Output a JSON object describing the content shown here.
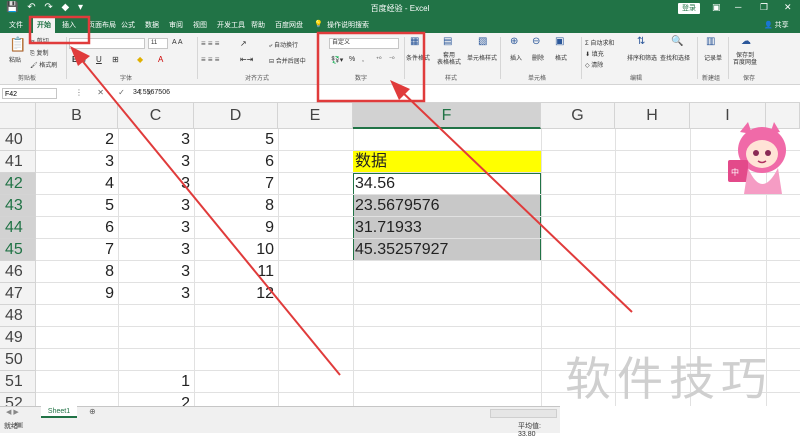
{
  "titlebar": {
    "title": "百度经验 - Excel",
    "login": "登录",
    "qat_icons": [
      "save-icon",
      "undo-icon",
      "redo-icon",
      "paint-icon",
      "dropdown-icon"
    ]
  },
  "tabs": [
    "文件",
    "开始",
    "插入",
    "页面布局",
    "公式",
    "数据",
    "审阅",
    "视图",
    "开发工具",
    "帮助",
    "百度网盘",
    "操作说明搜索"
  ],
  "share": "共享",
  "ribbon": {
    "clipboard": {
      "paste": "粘贴",
      "cut": "剪切",
      "copy": "复制",
      "painter": "格式刷",
      "group": "剪贴板"
    },
    "font": {
      "font_size": "11",
      "group": "字体"
    },
    "alignment": {
      "wrap": "自动换行",
      "merge": "合并后居中",
      "group": "对齐方式"
    },
    "number": {
      "format": "自定义",
      "percent": "%",
      "group": "数字"
    },
    "styles": {
      "cond": "条件格式",
      "table": "套用\n表格格式",
      "cell": "单元格样式",
      "group": "样式"
    },
    "cells": {
      "insert": "插入",
      "delete": "删除",
      "format": "格式",
      "group": "单元格"
    },
    "editing": {
      "autosum": "自动求和",
      "fill": "填充",
      "clear": "清除",
      "sort": "排序和筛选",
      "find": "查找和选择",
      "group": "编辑"
    },
    "newgroup": {
      "record": "记录单",
      "group": "新建组"
    },
    "save": {
      "label": "保存到\n百度网盘",
      "group": "保存"
    }
  },
  "formula": {
    "namebox": "F42",
    "value": "34.5567506"
  },
  "columns": [
    "B",
    "C",
    "D",
    "E",
    "F",
    "G",
    "H",
    "I"
  ],
  "rows": [
    {
      "n": "40",
      "B": "2",
      "C": "3",
      "D": "5"
    },
    {
      "n": "41",
      "B": "3",
      "C": "3",
      "D": "6",
      "F": "数据"
    },
    {
      "n": "42",
      "B": "4",
      "C": "3",
      "D": "7",
      "F": "34.56"
    },
    {
      "n": "43",
      "B": "5",
      "C": "3",
      "D": "8",
      "F": "23.5679576"
    },
    {
      "n": "44",
      "B": "6",
      "C": "3",
      "D": "9",
      "F": "31.71933"
    },
    {
      "n": "45",
      "B": "7",
      "C": "3",
      "D": "10",
      "F": "45.35257927"
    },
    {
      "n": "46",
      "B": "8",
      "C": "3",
      "D": "11"
    },
    {
      "n": "47",
      "B": "9",
      "C": "3",
      "D": "12"
    },
    {
      "n": "48"
    },
    {
      "n": "49"
    },
    {
      "n": "50"
    },
    {
      "n": "51",
      "C": "1"
    },
    {
      "n": "52",
      "C": "2"
    }
  ],
  "sheet_tab": "Sheet1",
  "status": {
    "left": "就绪",
    "right": "平均值: 33.80"
  },
  "watermark": "软件技巧",
  "colors": {
    "excel_green": "#217346",
    "highlight_red": "#e03b3b",
    "yellow_cell": "#ffff00",
    "gray_cell": "#c8c8c8"
  }
}
